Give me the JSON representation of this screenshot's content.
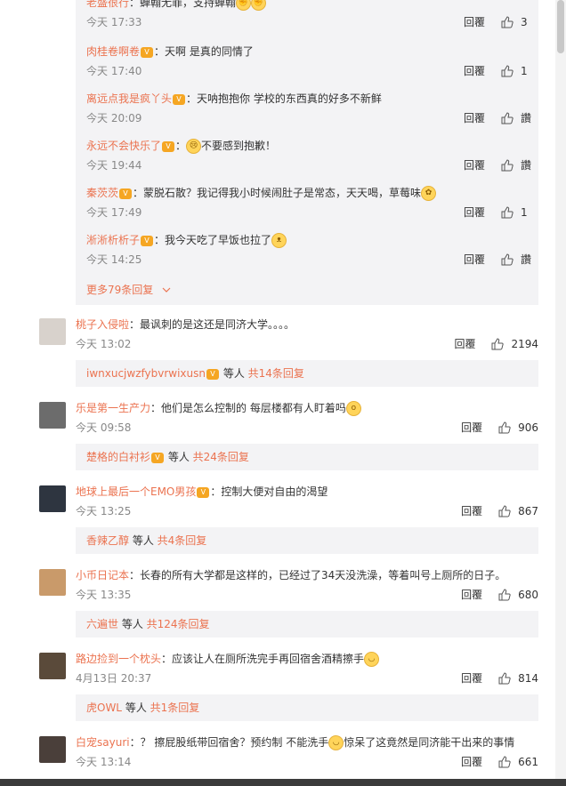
{
  "replies": [
    {
      "name": "老盛很行",
      "text": "：蝉翰无罪，支持蝉翰",
      "time": "今天 17:33",
      "reply_label": "回覆",
      "likes": "3"
    },
    {
      "name": "肉桂卷啊卷",
      "text": "：天啊 是真的同情了",
      "time": "今天 17:40",
      "reply_label": "回覆",
      "likes": "1"
    },
    {
      "name": "离远点我是疯丫头",
      "text": "：天呐抱抱你 学校的东西真的好多不新鲜",
      "time": "今天 20:09",
      "reply_label": "回覆",
      "likes": "讚"
    },
    {
      "name": "永远不会快乐了",
      "text": "不要感到抱歉！",
      "time": "今天 19:44",
      "reply_label": "回覆",
      "likes": "讚"
    },
    {
      "name": "秦茨茨",
      "text": "：蒙脱石散？我记得我小时候闹肚子是常态，天天喝，草莓味",
      "time": "今天 17:49",
      "reply_label": "回覆",
      "likes": "1"
    },
    {
      "name": "淅淅析析子",
      "text": "：我今天吃了早饭也拉了",
      "time": "今天 14:25",
      "reply_label": "回覆",
      "likes": "讚"
    }
  ],
  "more_replies": "更多79条回复",
  "comments": [
    {
      "name": "桃子入侵啦",
      "text": "：最讽刺的是这还是同济大学。。。。",
      "time": "今天 13:02",
      "reply_label": "回覆",
      "likes": "2194",
      "sub_name": "iwnxucjwzfybvrwixusn",
      "sub_mid": " 等人 ",
      "sub_count": "共14条回复"
    },
    {
      "name": "乐是第一生产力",
      "text": "：他们是怎么控制的 每层楼都有人盯着吗",
      "time": "今天 09:58",
      "reply_label": "回覆",
      "likes": "906",
      "sub_name": "楚格的白衬衫",
      "sub_mid": " 等人 ",
      "sub_count": "共24条回复"
    },
    {
      "name": "地球上最后一个EMO男孩",
      "text": "：控制大便对自由的渴望",
      "time": "今天 13:25",
      "reply_label": "回覆",
      "likes": "867",
      "sub_name": "香辣乙醇",
      "sub_mid": " 等人 ",
      "sub_count": "共4条回复"
    },
    {
      "name": "小币日记本",
      "text": "：长春的所有大学都是这样的，已经过了34天没洗澡，等着叫号上厕所的日子。",
      "time": "今天 13:35",
      "reply_label": "回覆",
      "likes": "680",
      "sub_name": "六遍世",
      "sub_mid": " 等人 ",
      "sub_count": "共124条回复"
    },
    {
      "name": "路边捡到一个枕头",
      "text": "：应该让人在厕所洗完手再回宿舍酒精擦手",
      "time": "4月13日 20:37",
      "reply_label": "回覆",
      "likes": "814",
      "sub_name": "虎OWL",
      "sub_mid": " 等人 ",
      "sub_count": "共1条回复"
    },
    {
      "name": "白宠sayuri",
      "text": "：？ 擦屁股纸带回宿舍？预约制 不能洗手",
      "text2": "惊呆了这竟然是同济能干出来的事情",
      "time": "今天 13:14",
      "reply_label": "回覆",
      "likes": "661"
    }
  ],
  "colors": {
    "name": "#eb7350",
    "bg_reply": "#f3f3f5"
  }
}
